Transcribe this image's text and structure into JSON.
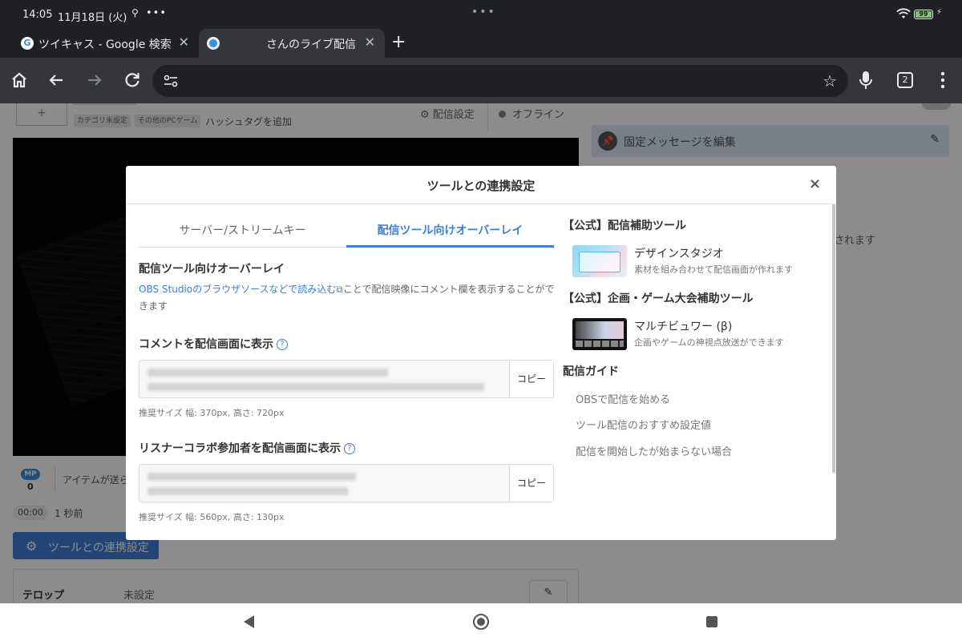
{
  "status_bar": {
    "time": "14:05",
    "date": "11月18日 (火)",
    "more": "•••",
    "center": "•••",
    "battery": "99",
    "charging_icon": "bolt-icon"
  },
  "browser": {
    "tabs": [
      {
        "title": "ツイキャス - Google 検索",
        "favicon": "G"
      },
      {
        "title": "さんのライブ配信",
        "favicon": ""
      }
    ],
    "new_tab": "+",
    "tab_close": "✕",
    "tab_count": "2"
  },
  "page": {
    "add_button": "+",
    "tags": [
      "カテゴリ未設定",
      "その他のPCゲーム"
    ],
    "hashtag": "ハッシュタグを追加",
    "settings": "配信設定",
    "status": "オフライン",
    "pinned_message": "固定メッセージを編集",
    "right_note": "されます",
    "mp_label": "MP",
    "mp_value": "0",
    "items_text": "アイテムが送ら",
    "timer": "00:00",
    "ago": "1 秒前",
    "tool_button": "ツールとの連携設定",
    "telop_label": "テロップ",
    "telop_value": "未設定"
  },
  "modal": {
    "title": "ツールとの連携設定",
    "close": "×",
    "tabs": [
      "サーバー/ストリームキー",
      "配信ツール向けオーバーレイ"
    ],
    "active_tab": 1,
    "section_title": "配信ツール向けオーバーレイ",
    "description_link": "OBS Studioのブラウザソースなどで読み込む",
    "description_rest": "ことで配信映像にコメント欄を表示することができます",
    "comment_heading": "コメントを配信画面に表示",
    "comment_recommend": "推奨サイズ 幅: 370px, 高さ: 720px",
    "listener_heading": "リスナーコラボ参加者を配信画面に表示",
    "listener_recommend": "推奨サイズ 幅: 560px, 高さ: 130px",
    "copy_label": "コピー",
    "help_glyph": "?",
    "right": {
      "official_tools_heading": "【公式】配信補助ツール",
      "design_studio_name": "デザインスタジオ",
      "design_studio_desc": "素材を組み合わせて配信画面が作れます",
      "event_tools_heading": "【公式】企画・ゲーム大会補助ツール",
      "multiviewer_name": "マルチビュワー (β)",
      "multiviewer_desc": "企画やゲームの神視点放送ができます",
      "guide_heading": "配信ガイド",
      "guides": [
        "OBSで配信を始める",
        "ツール配信のおすすめ設定値",
        "配信を開始したが始まらない場合"
      ]
    }
  }
}
